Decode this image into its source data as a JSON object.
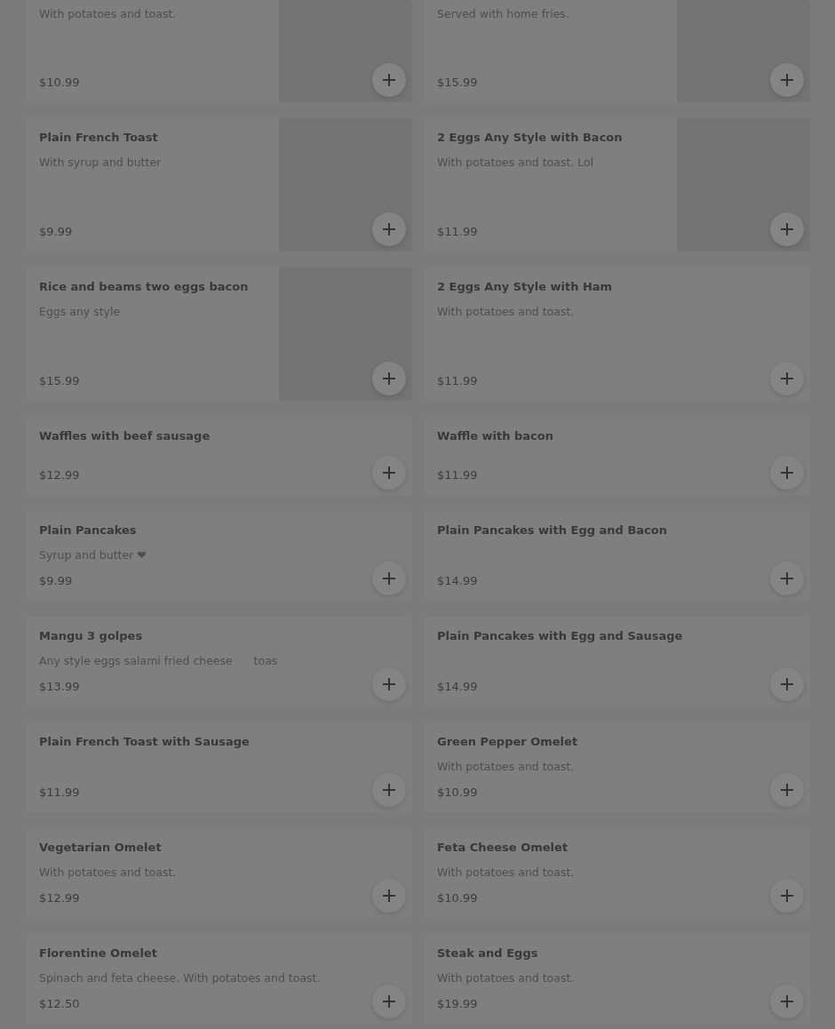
{
  "items": [
    {
      "description": "With potatoes and toast.",
      "price": "$10.99",
      "kind": "picture"
    },
    {
      "description": "Served with home fries.",
      "price": "$15.99",
      "kind": "picture"
    },
    {
      "name": "Plain French Toast",
      "description": "With syrup and butter",
      "price": "$9.99",
      "kind": "picture"
    },
    {
      "name": "2 Eggs Any Style with Bacon",
      "description": "With potatoes and toast. Lol",
      "price": "$11.99",
      "kind": "picture"
    },
    {
      "name": "Rice and beams two eggs bacon",
      "description": "Eggs any style",
      "price": "$15.99",
      "kind": "picture"
    },
    {
      "name": "2 Eggs Any Style with Ham",
      "description": "With potatoes and toast.",
      "price": "$11.99",
      "kind": "tall"
    },
    {
      "name": "Waffles with beef sausage",
      "price": "$12.99"
    },
    {
      "name": "Waffle with bacon",
      "price": "$11.99"
    },
    {
      "name": "Plain Pancakes",
      "description": "Syrup and butter ❤",
      "price": "$9.99"
    },
    {
      "name": "Plain Pancakes with Egg and Bacon",
      "price": "$14.99"
    },
    {
      "name": "Mangu 3 golpes",
      "description": "Any style eggs salami fried cheese      toas",
      "price": "$13.99"
    },
    {
      "name": "Plain Pancakes with Egg and Sausage",
      "price": "$14.99"
    },
    {
      "name": "Plain French Toast with Sausage",
      "price": "$11.99"
    },
    {
      "name": "Green Pepper Omelet",
      "description": "With potatoes and toast.",
      "price": "$10.99"
    },
    {
      "name": "Vegetarian Omelet",
      "description": "With potatoes and toast.",
      "price": "$12.99"
    },
    {
      "name": "Feta Cheese Omelet",
      "description": "With potatoes and toast.",
      "price": "$10.99"
    },
    {
      "name": "Florentine Omelet",
      "description": "Spinach and feta cheese. With potatoes and toast.",
      "price": "$12.50"
    },
    {
      "name": "Steak and Eggs",
      "description": "With potatoes and toast.",
      "price": "$19.99"
    }
  ]
}
